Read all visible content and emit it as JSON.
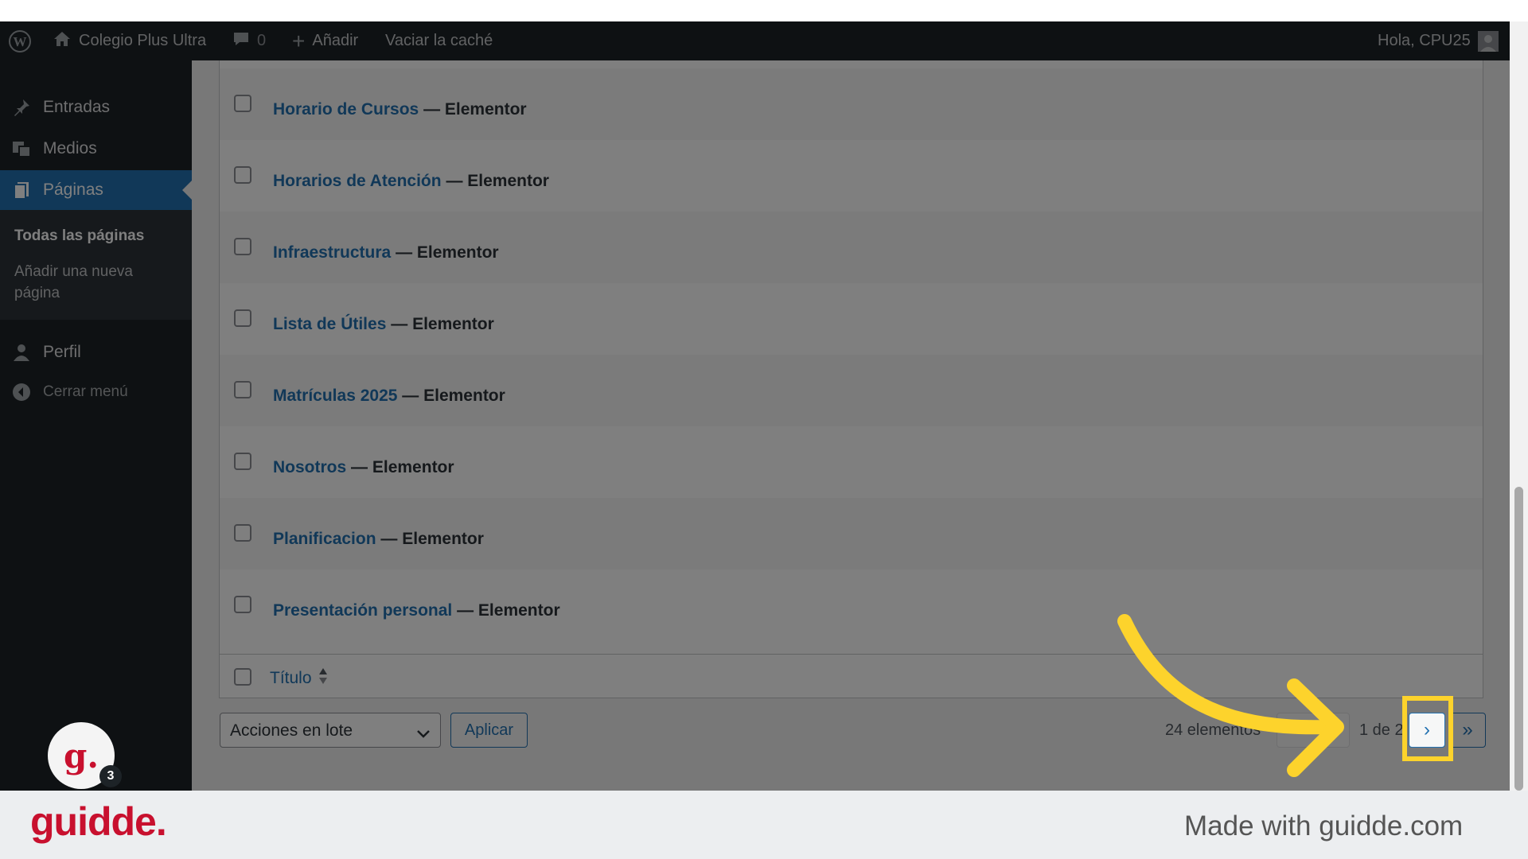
{
  "adminbar": {
    "site_name": "Colegio Plus Ultra",
    "comments_count": "0",
    "add_label": "Añadir",
    "cache_label": "Vaciar la caché",
    "greeting": "Hola, CPU25"
  },
  "sidebar": {
    "items": [
      {
        "label": "Entradas",
        "icon": "pin-icon"
      },
      {
        "label": "Medios",
        "icon": "media-icon"
      },
      {
        "label": "Páginas",
        "icon": "pages-icon"
      }
    ],
    "submenu": {
      "all_pages": "Todas las páginas",
      "add_new": "Añadir una nueva página"
    },
    "profile": "Perfil",
    "collapse": "Cerrar menú"
  },
  "pages": [
    {
      "title": "Horario de Cursos",
      "state": "— Elementor"
    },
    {
      "title": "Horarios de Atención",
      "state": "— Elementor"
    },
    {
      "title": "Infraestructura",
      "state": "— Elementor"
    },
    {
      "title": "Lista de Útiles",
      "state": "— Elementor"
    },
    {
      "title": "Matrículas 2025",
      "state": "— Elementor"
    },
    {
      "title": "Nosotros",
      "state": "— Elementor"
    },
    {
      "title": "Planificacion",
      "state": "— Elementor"
    },
    {
      "title": "Presentación personal",
      "state": "— Elementor"
    }
  ],
  "table": {
    "column_title": "Título"
  },
  "bulk": {
    "select_label": "Acciones en lote",
    "apply_label": "Aplicar"
  },
  "pagination": {
    "count": "24 elementos",
    "page_info": "1 de 2",
    "next": "›",
    "last": "»"
  },
  "guidde": {
    "avatar_letter": "g.",
    "badge_count": "3",
    "brand": "guidde.",
    "made_with": "Made with guidde.com"
  },
  "colors": {
    "highlight": "#fdd32c",
    "brand_red": "#c8102e",
    "wp_blue": "#2271b1"
  }
}
